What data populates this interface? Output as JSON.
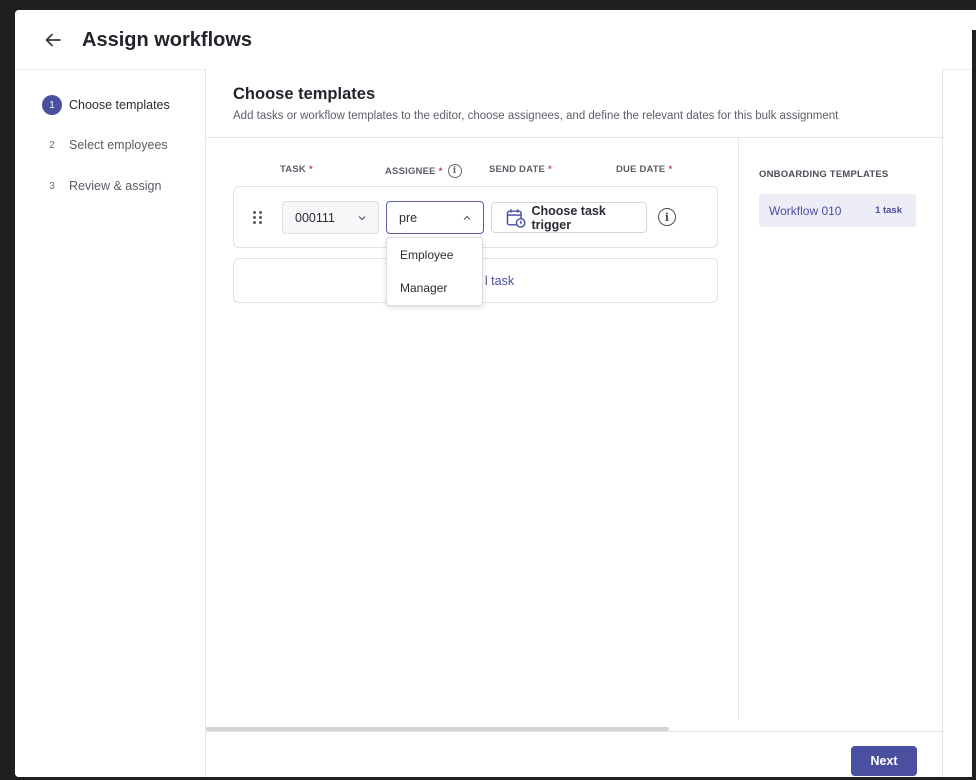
{
  "header": {
    "title": "Assign workflows",
    "back_icon": "arrow-left-icon"
  },
  "steps": [
    {
      "number": "1",
      "label": "Choose templates",
      "active": true
    },
    {
      "number": "2",
      "label": "Select employees",
      "active": false
    },
    {
      "number": "3",
      "label": "Review & assign",
      "active": false
    }
  ],
  "main": {
    "title": "Choose templates",
    "subtitle": "Add tasks or workflow templates to the editor, choose assignees, and define the relevant dates for this bulk assignment",
    "columns": {
      "task": "TASK",
      "assignee": "ASSIGNEE",
      "send_date": "SEND DATE",
      "due_date": "DUE DATE",
      "required_mark": "*"
    },
    "row": {
      "task_value": "000111",
      "assignee_value": "pre",
      "trigger_label": "Choose task trigger"
    },
    "assignee_options": [
      "Employee",
      "Manager"
    ],
    "add_task_label": "l task"
  },
  "templates": {
    "heading": "ONBOARDING TEMPLATES",
    "items": [
      {
        "name": "Workflow 010",
        "count": "1 task"
      }
    ]
  },
  "footer": {
    "next_label": "Next"
  },
  "colors": {
    "accent": "#4a4fa0",
    "template_bg": "#ededf7",
    "required": "#d0455f"
  }
}
